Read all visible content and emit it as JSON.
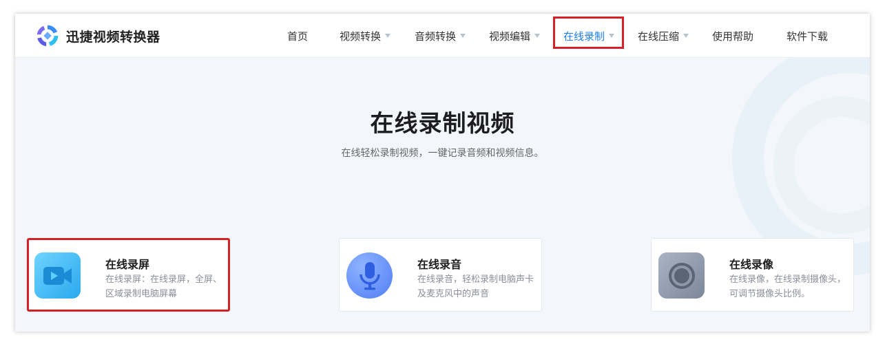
{
  "brand": {
    "name": "迅捷视频转换器"
  },
  "nav": {
    "items": [
      {
        "label": "首页",
        "dropdown": false
      },
      {
        "label": "视频转换",
        "dropdown": true
      },
      {
        "label": "音频转换",
        "dropdown": true
      },
      {
        "label": "视频编辑",
        "dropdown": true
      },
      {
        "label": "在线录制",
        "dropdown": true,
        "active": true
      },
      {
        "label": "在线压缩",
        "dropdown": true
      },
      {
        "label": "使用帮助",
        "dropdown": false
      },
      {
        "label": "软件下载",
        "dropdown": false
      }
    ]
  },
  "hero": {
    "title": "在线录制视频",
    "subtitle": "在线轻松录制视频，一键记录音频和视频信息。"
  },
  "cards": [
    {
      "title": "在线录屏",
      "desc": "在线录屏：在线录屏，全屏、区域录制电脑屏幕",
      "icon": "video-camera-icon"
    },
    {
      "title": "在线录音",
      "desc": "在线录音，轻松录制电脑声卡及麦克风中的声音",
      "icon": "microphone-icon"
    },
    {
      "title": "在线录像",
      "desc": "在线录像，在线录制摄像头，可调节摄像头比例。",
      "icon": "camera-lens-icon"
    }
  ],
  "colors": {
    "accent": "#1e7ff0",
    "highlight": "#d42027"
  }
}
